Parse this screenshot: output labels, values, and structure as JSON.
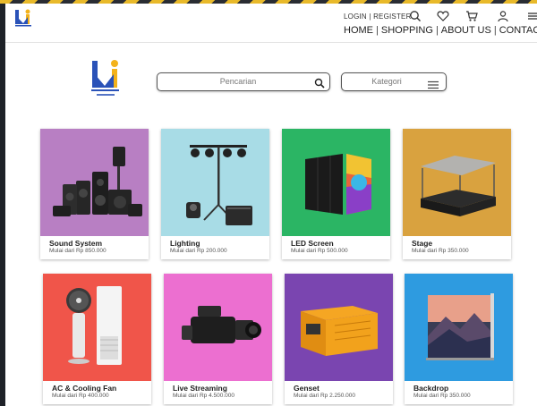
{
  "header": {
    "auth": {
      "login": "LOGIN",
      "separator": "|",
      "register": "REGISTER"
    },
    "icons": [
      "search-icon",
      "heart-icon",
      "cart-icon",
      "user-icon",
      "menu-icon"
    ],
    "nav": [
      {
        "label": "HOME"
      },
      {
        "label": "SHOPPING"
      },
      {
        "label": "ABOUT US"
      },
      {
        "label": "CONTACT US"
      }
    ]
  },
  "search": {
    "placeholder": "Pencarian"
  },
  "kategori": {
    "label": "Kategori"
  },
  "products": [
    {
      "title": "Sound System",
      "price": "Mulai dari Rp 850.000",
      "bg": "#b87fc3",
      "icon": "speaker-icon"
    },
    {
      "title": "Lighting",
      "price": "Mulai dari Rp 200.000",
      "bg": "#a8dce6",
      "icon": "stage-light-icon"
    },
    {
      "title": "LED Screen",
      "price": "Mulai dari Rp 500.000",
      "bg": "#2bb564",
      "icon": "led-screen-icon"
    },
    {
      "title": "Stage",
      "price": "Mulai dari Rp 350.000",
      "bg": "#d9a23f",
      "icon": "stage-icon"
    },
    {
      "title": "AC & Cooling Fan",
      "price": "Mulai dari Rp 400.000",
      "bg": "#f0554a",
      "icon": "cooling-fan-icon"
    },
    {
      "title": "Live Streaming",
      "price": "Mulai dari Rp 4.500.000",
      "bg": "#ec6fd0",
      "icon": "video-camera-icon"
    },
    {
      "title": "Genset",
      "price": "Mulai dari Rp 2.250.000",
      "bg": "#7a45b0",
      "icon": "generator-icon"
    },
    {
      "title": "Backdrop",
      "price": "Mulai dari Rp 350.000",
      "bg": "#2e9be0",
      "icon": "backdrop-icon"
    }
  ],
  "colors": {
    "logo_blue": "#2a52b8",
    "logo_yellow": "#f3b21b"
  }
}
